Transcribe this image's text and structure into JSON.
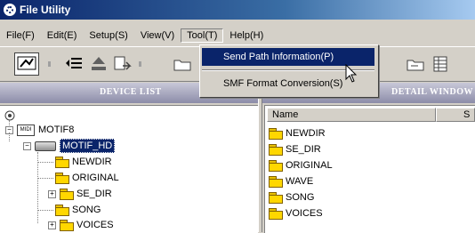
{
  "window": {
    "title": "File Utility"
  },
  "menubar": {
    "items": [
      {
        "label": "File(F)"
      },
      {
        "label": "Edit(E)"
      },
      {
        "label": "Setup(S)"
      },
      {
        "label": "View(V)"
      },
      {
        "label": "Tool(T)"
      },
      {
        "label": "Help(H)"
      }
    ]
  },
  "dropdown": {
    "items": [
      {
        "label": "Send Path Information(P)"
      },
      {
        "label": "SMF Format Conversion(S)"
      }
    ]
  },
  "headers": {
    "left": "DEVICE LIST",
    "right": "DETAIL WINDOW"
  },
  "tree": {
    "root": "MOTIF8",
    "root_icon_text": "MIDI",
    "drive": "MOTIF_HD",
    "folders": [
      "NEWDIR",
      "ORIGINAL",
      "SE_DIR",
      "SONG",
      "VOICES"
    ]
  },
  "detail": {
    "columns": [
      "Name",
      "S"
    ],
    "files": [
      "NEWDIR",
      "SE_DIR",
      "ORIGINAL",
      "WAVE",
      "SONG",
      "VOICES"
    ]
  },
  "icons": {
    "toolbar": [
      "device-icon",
      "list-icon",
      "eject-icon",
      "copy-icon",
      "folder-new-icon",
      "folder-icon",
      "grid-icon"
    ]
  }
}
